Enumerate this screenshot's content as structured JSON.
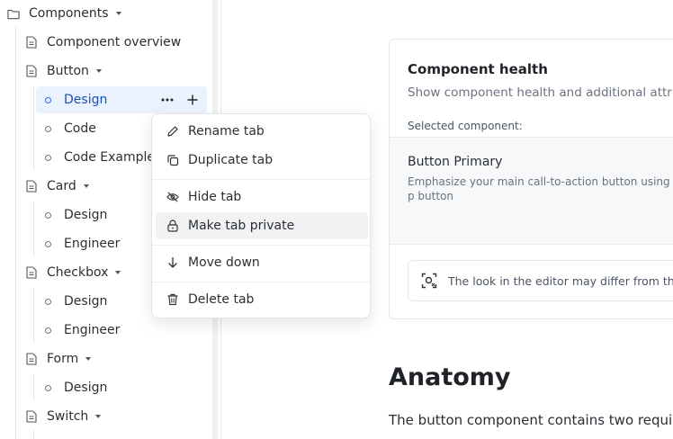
{
  "sidebar": {
    "root": {
      "label": "Components",
      "icon": "folder-icon"
    },
    "items": [
      {
        "label": "Component overview",
        "icon": "page-icon"
      },
      {
        "label": "Button",
        "icon": "page-icon",
        "expanded": true
      },
      {
        "label": "Design",
        "active": true
      },
      {
        "label": "Code"
      },
      {
        "label": "Code Examples"
      },
      {
        "label": "Card",
        "icon": "page-icon",
        "expanded": true
      },
      {
        "label": "Design"
      },
      {
        "label": "Engineer"
      },
      {
        "label": "Checkbox",
        "icon": "page-icon",
        "expanded": true
      },
      {
        "label": "Design"
      },
      {
        "label": "Engineer"
      },
      {
        "label": "Form",
        "icon": "page-icon",
        "expanded": true
      },
      {
        "label": "Design"
      },
      {
        "label": "Switch",
        "icon": "page-icon",
        "expanded": true
      }
    ],
    "row_actions": {
      "more": "more-icon",
      "add": "plus-icon"
    }
  },
  "context_menu": {
    "items": [
      {
        "label": "Rename tab",
        "icon": "pencil-icon"
      },
      {
        "label": "Duplicate tab",
        "icon": "duplicate-icon"
      },
      {
        "label": "Hide tab",
        "icon": "eye-off-icon"
      },
      {
        "label": "Make tab private",
        "icon": "lock-icon",
        "hovered": true
      },
      {
        "label": "Move down",
        "icon": "arrow-down-icon"
      },
      {
        "label": "Delete tab",
        "icon": "trash-icon"
      }
    ]
  },
  "main": {
    "card": {
      "title": "Component health",
      "subtitle": "Show component health and additional attrib",
      "selected_label": "Selected component:",
      "component_name": "Button Primary",
      "component_desc": "Emphasize your main call-to-action button using a p button",
      "notice": "The look in the editor may differ from the pu"
    },
    "heading": "Anatomy",
    "paragraph": "The button component contains two requi"
  },
  "colors": {
    "accent": "#2f6fe0",
    "active_bg": "#eaf2fe",
    "active_text": "#1a4fb3"
  }
}
